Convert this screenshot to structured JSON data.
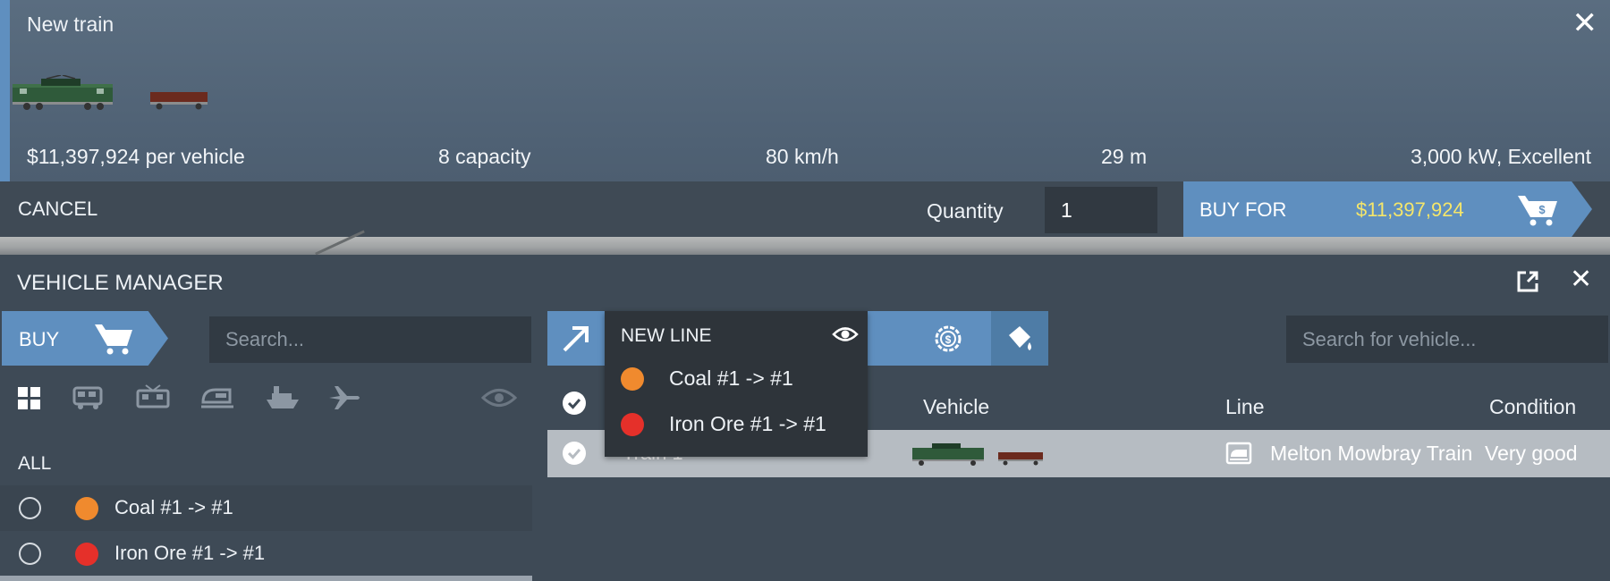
{
  "colors": {
    "accent": "#5f8fbf",
    "price_highlight": "#f5e66a",
    "coal": "#f08a2e",
    "iron_ore": "#e5302a"
  },
  "new_train": {
    "title": "New train",
    "close_icon": "close-icon",
    "stats": {
      "price": "$11,397,924 per vehicle",
      "capacity": "8 capacity",
      "speed": "80 km/h",
      "length": "29 m",
      "power": "3,000 kW, Excellent"
    },
    "cancel_label": "CANCEL",
    "quantity_label": "Quantity",
    "quantity_value": "1",
    "buy_for_label": "BUY FOR",
    "buy_for_price": "$11,397,924"
  },
  "vehicle_manager": {
    "title": "VEHICLE MANAGER",
    "buy_label": "BUY",
    "search_placeholder": "Search...",
    "vehicle_search_placeholder": "Search for vehicle...",
    "filter_icons": [
      "grid-icon",
      "bus-icon",
      "tram-icon",
      "train-icon",
      "ship-icon",
      "plane-icon",
      "eye-icon"
    ],
    "all_label": "ALL",
    "lines": [
      {
        "name": "Coal #1 -> #1",
        "color": "#f08a2e"
      },
      {
        "name": "Iron Ore #1 -> #1",
        "color": "#e5302a"
      }
    ],
    "table": {
      "headers": {
        "vehicle": "Vehicle",
        "line": "Line",
        "condition": "Condition"
      },
      "rows": [
        {
          "name": "Train 1",
          "line": "Melton Mowbray Train",
          "condition": "Very good"
        }
      ]
    },
    "dropdown": {
      "header": "NEW LINE",
      "items": [
        {
          "name": "Coal #1 -> #1",
          "color": "#f08a2e"
        },
        {
          "name": "Iron Ore #1 -> #1",
          "color": "#e5302a"
        }
      ]
    }
  }
}
